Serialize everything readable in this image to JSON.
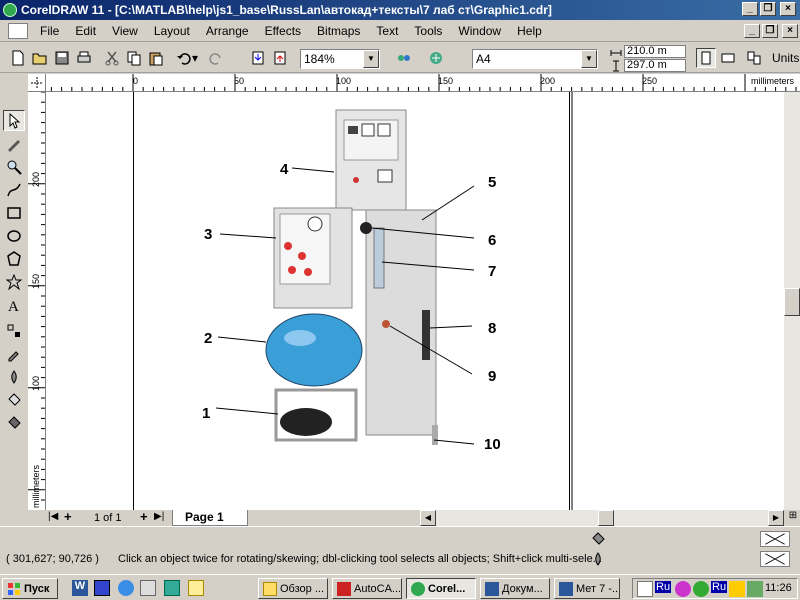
{
  "window": {
    "title": "CorelDRAW 11 - [C:\\MATLAB\\help\\js1_base\\RussLan\\автокад+тексты\\7 лаб ст\\Graphic1.cdr]"
  },
  "menu": [
    "File",
    "Edit",
    "View",
    "Layout",
    "Arrange",
    "Effects",
    "Bitmaps",
    "Text",
    "Tools",
    "Window",
    "Help"
  ],
  "toolbar": {
    "zoom": "184%",
    "paper": "A4",
    "width": "210.0 m",
    "height": "297.0 m",
    "units_label": "Units:"
  },
  "ruler": {
    "units": "millimeters",
    "h_ticks": [
      "0",
      "50",
      "100",
      "150",
      "200",
      "250"
    ],
    "v_ticks": [
      "200",
      "150",
      "100"
    ]
  },
  "page_nav": {
    "count": "1 of 1",
    "tab": "Page 1"
  },
  "status": {
    "coords": "( 301,627; 90,726 )",
    "hint": "Click an object twice for rotating/skewing; dbl-clicking tool selects all objects; Shift+click multi-sele..."
  },
  "drawing": {
    "callouts": [
      "1",
      "2",
      "3",
      "4",
      "5",
      "6",
      "7",
      "8",
      "9",
      "10"
    ]
  },
  "taskbar": {
    "start": "Пуск",
    "tasks": [
      "Обзор ...",
      "AutoCA...",
      "Corel...",
      "Докум...",
      "Мет 7 -..."
    ],
    "lang": "Ru",
    "lang2": "Ru",
    "clock": "11:26"
  },
  "colors": {
    "title_start": "#0a246a",
    "title_end": "#3a6ea5",
    "tank_blue": "#3a9fd6"
  }
}
